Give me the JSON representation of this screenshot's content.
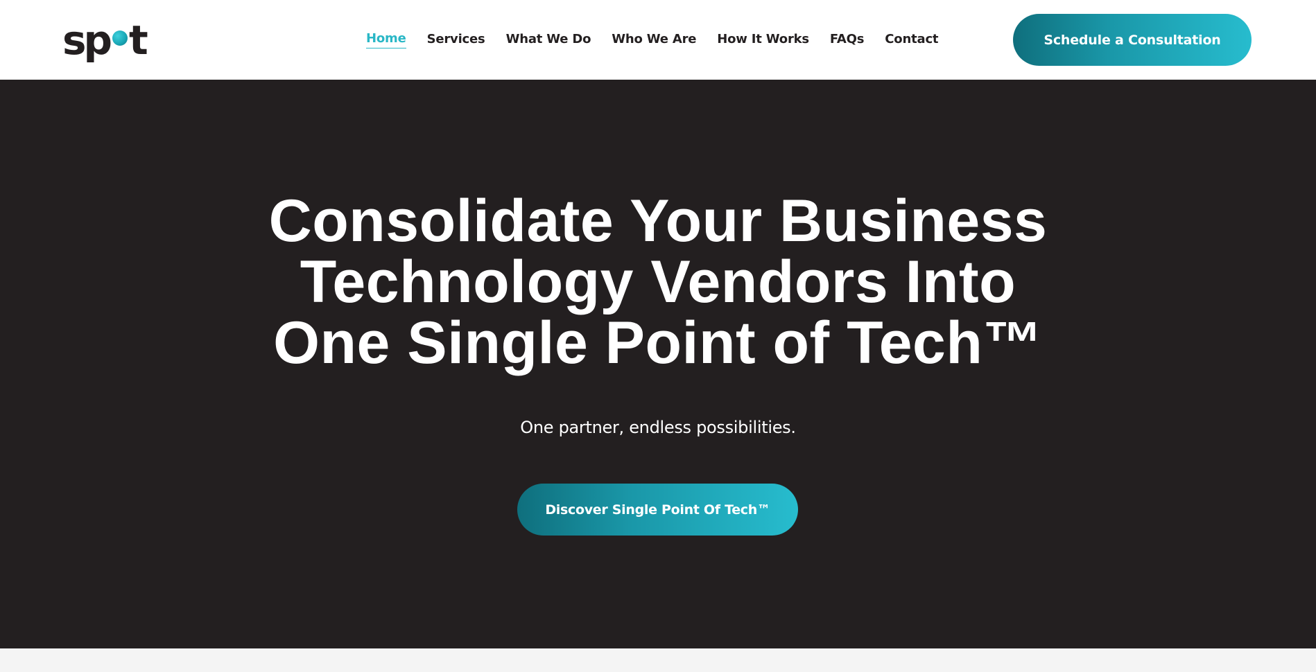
{
  "brand": {
    "logo_left": "sp",
    "logo_right": "t",
    "accent_color": "#2ab7c6",
    "dark_color": "#231f20"
  },
  "nav": {
    "items": [
      {
        "label": "Home",
        "active": true
      },
      {
        "label": "Services",
        "active": false
      },
      {
        "label": "What We Do",
        "active": false
      },
      {
        "label": "Who We Are",
        "active": false
      },
      {
        "label": "How It Works",
        "active": false
      },
      {
        "label": "FAQs",
        "active": false
      },
      {
        "label": "Contact",
        "active": false
      }
    ],
    "cta_label": "Schedule a Consultation"
  },
  "hero": {
    "title_lines": [
      "Consolidate Your Business",
      "Technology Vendors Into",
      "One Single Point of Tech™"
    ],
    "subtitle": "One partner, endless possibilities.",
    "cta_label": "Discover Single Point Of Tech™"
  }
}
